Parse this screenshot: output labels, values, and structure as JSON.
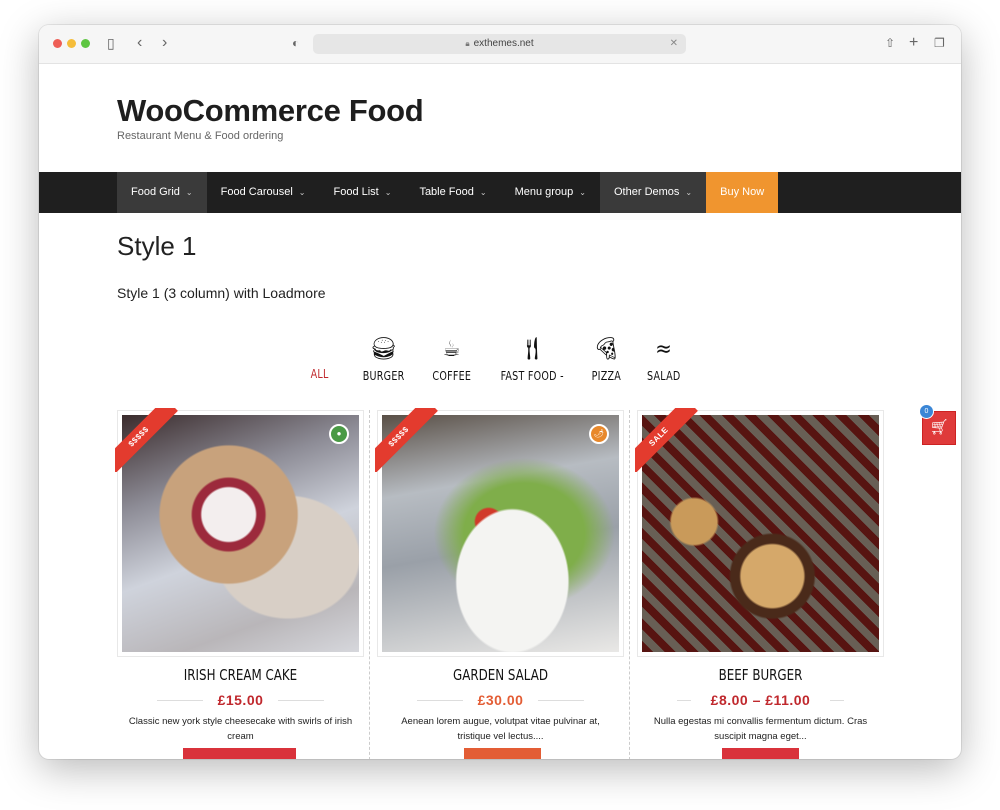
{
  "browser": {
    "url": "exthemes.net",
    "icons": [
      "sidebar-icon",
      "back-icon",
      "forward-icon",
      "shield-icon",
      "share-icon",
      "new-tab-icon",
      "tabs-icon"
    ]
  },
  "site": {
    "title": "WooCommerce Food",
    "tagline": "Restaurant Menu & Food ordering"
  },
  "nav": {
    "items": [
      {
        "label": "Food Grid",
        "dropdown": true
      },
      {
        "label": "Food Carousel",
        "dropdown": true
      },
      {
        "label": "Food List",
        "dropdown": true
      },
      {
        "label": "Table Food",
        "dropdown": true
      },
      {
        "label": "Menu group",
        "dropdown": true
      },
      {
        "label": "Other Demos",
        "dropdown": true
      },
      {
        "label": "Buy Now",
        "dropdown": false
      }
    ],
    "chevron": "⌄",
    "colors": {
      "bar": "#1f1f1f",
      "active": "#3a3a3a",
      "buy": "#f0952f"
    }
  },
  "main": {
    "heading": "Style 1",
    "subheading": "Style 1 (3 column) with Loadmore"
  },
  "filters": [
    {
      "label": "ALL",
      "icon": "",
      "active": true
    },
    {
      "label": "BURGER",
      "icon": "burger-icon"
    },
    {
      "label": "COFFEE",
      "icon": "coffee-icon"
    },
    {
      "label": "FAST FOOD -",
      "icon": "cutlery-icon"
    },
    {
      "label": "PIZZA",
      "icon": "pizza-icon"
    },
    {
      "label": "SALAD",
      "icon": "bacon-icon"
    }
  ],
  "products": [
    {
      "name": "IRISH CREAM CAKE",
      "price": "£15.00",
      "ribbon": "$$$$$",
      "badge": "vegetarian",
      "badge_color": "#4a9a45",
      "description": "Classic new york style cheesecake with swirls of irish cream",
      "button_color": "#d9323b",
      "price_color": "#c0282d"
    },
    {
      "name": "GARDEN SALAD",
      "price": "£30.00",
      "ribbon": "$$$$$",
      "badge": "spicy",
      "badge_color": "#e8882b",
      "description": "Aenean lorem augue, volutpat vitae pulvinar at, tristique vel lectus....",
      "button_color": "#e35d35",
      "price_color": "#e35d35"
    },
    {
      "name": "BEEF BURGER",
      "price": "£8.00 – £11.00",
      "ribbon": "SALE",
      "badge": "",
      "description": "Nulla egestas mi convallis fermentum dictum. Cras suscipit magna eget...",
      "button_color": "#d9323b",
      "price_color": "#c0282d"
    }
  ],
  "cart": {
    "count": "0",
    "color": "#df3a3a"
  }
}
